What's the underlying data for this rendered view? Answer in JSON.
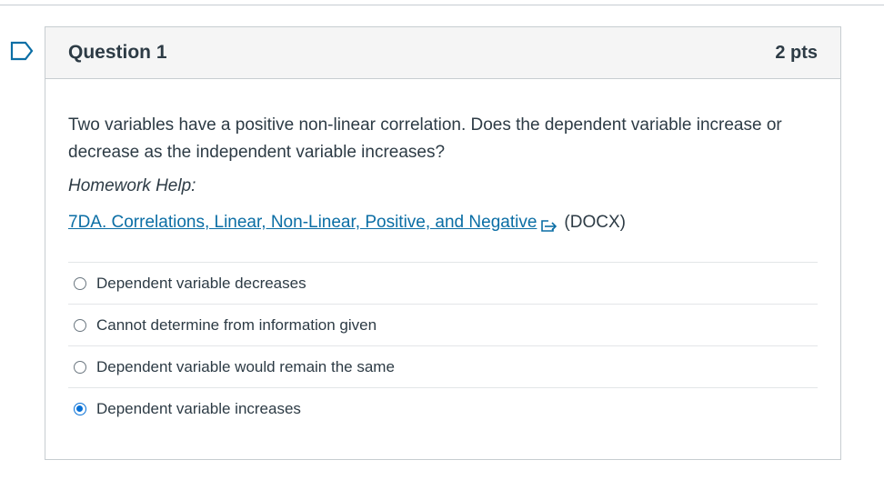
{
  "question": {
    "title": "Question 1",
    "points": "2 pts",
    "text": "Two variables have a positive non-linear correlation. Does the dependent variable increase or decrease as the independent variable increases?",
    "homework_help_label": "Homework Help:",
    "link_text": "7DA. Correlations, Linear, Non-Linear, Positive, and Negative",
    "link_file_type": "(DOCX)"
  },
  "answers": [
    {
      "label": "Dependent variable decreases",
      "selected": false
    },
    {
      "label": "Cannot determine from information given",
      "selected": false
    },
    {
      "label": "Dependent variable would remain the same",
      "selected": false
    },
    {
      "label": "Dependent variable increases",
      "selected": true
    }
  ],
  "colors": {
    "accent": "#0770d6",
    "link": "#0b6ea5",
    "flag": "#0b6ea5",
    "text": "#2d3b45",
    "header_bg": "#f5f5f5",
    "border": "#c7cdd1"
  },
  "icons": {
    "flag": "flag-outline-icon",
    "external_link": "external-link-icon"
  }
}
